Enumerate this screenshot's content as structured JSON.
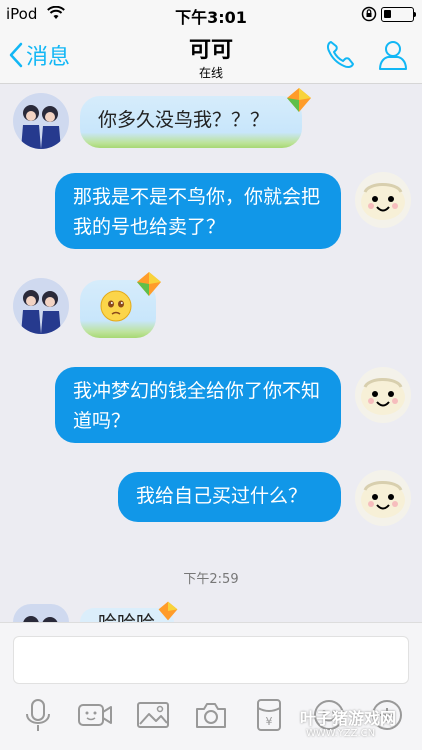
{
  "status_bar": {
    "carrier": "iPod",
    "time": "下午3:01"
  },
  "header": {
    "back_label": "消息",
    "title": "可可",
    "subtitle": "在线"
  },
  "messages": [
    {
      "side": "left",
      "text": "你多久没鸟我？？？"
    },
    {
      "side": "right",
      "text": "那我是不是不鸟你，你就会把我的号也给卖了？"
    },
    {
      "side": "left",
      "text": "",
      "emoji": "crying-emoji"
    },
    {
      "side": "right",
      "text": "我冲梦幻的钱全给你了你不知道吗？"
    },
    {
      "side": "right",
      "text": "我给自己买过什么？"
    }
  ],
  "timestamp": "下午2:59",
  "partial_message": {
    "side": "left",
    "text": "哈哈哈"
  },
  "input": {
    "placeholder": "",
    "value": ""
  },
  "toolbar": {
    "icons": [
      "microphone-icon",
      "video-icon",
      "image-icon",
      "camera-icon",
      "red-packet-icon",
      "emoji-icon",
      "plus-icon"
    ],
    "red_packet_symbol": "¥"
  },
  "watermark": {
    "main": "叶子猪游戏网",
    "sub": "WWW.YZZ.CN"
  },
  "colors": {
    "accent": "#12b7f5",
    "bubble_right": "#1197e8",
    "bubble_left": "#dbeefb"
  }
}
